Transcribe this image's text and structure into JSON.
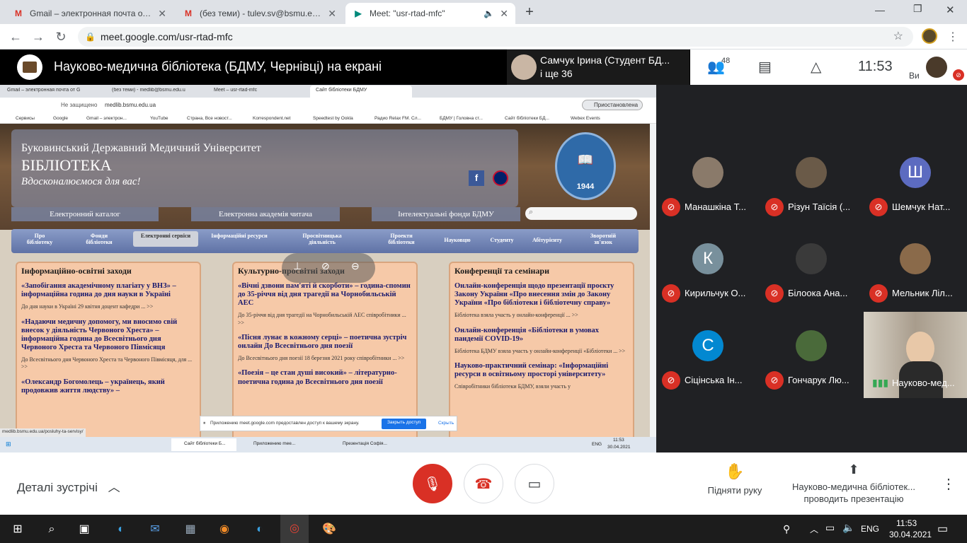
{
  "browser": {
    "tabs": [
      {
        "title": "Gmail – электронная почта от G",
        "icon": "gmail-icon"
      },
      {
        "title": "(без теми) - tulev.sv@bsmu.edu.u",
        "icon": "gmail-icon"
      },
      {
        "title": "Meet: \"usr-rtad-mfc\"",
        "icon": "meet-icon"
      }
    ],
    "url": "meet.google.com/usr-rtad-mfc"
  },
  "meet": {
    "presentation_title": "Науково-медична бібліотека (БДМУ, Чернівці) на екрані",
    "presenter_name": "Самчук Ірина (Студент БД...",
    "presenter_more": "і ще 36",
    "participant_count": "48",
    "time": "11:53",
    "self_label": "Ви"
  },
  "shared": {
    "tabs": [
      "Gmail – электронная почта от G",
      "(без теми) - medlib@bsmu.edu.u",
      "Meet – usr-rtad-mfc",
      "Сайт бібліотеки БДМУ"
    ],
    "not_secure": "Не защищено",
    "url": "medlib.bsmu.edu.ua",
    "paused": "Приостановлена",
    "bookmarks": [
      "Сервисы",
      "Google",
      "Gmail – электрон...",
      "YouTube",
      "Страна, Все новост...",
      "Korrespondent.net",
      "Speedtest by Ookla",
      "Радио Relax FM. Сл...",
      "БДМУ | Головна ст...",
      "Сайт бібліотеки БД...",
      "Webex Events"
    ],
    "university": "Буковинський Державний Медичний Університет",
    "library": "БІБЛІОТЕКА",
    "slogan": "Вдосконалюємося для вас!",
    "logo_year": "1944",
    "logo_text": "Бібліотека БДМУ",
    "btn_catalog": "Електронний каталог",
    "btn_academy": "Електронна академія читача",
    "btn_funds": "Інтелектуальні фонди БДМУ",
    "menu": [
      "Про бібліотеку",
      "Фонди бібліотеки",
      "Електронні сервіси",
      "Інформаційні ресурси",
      "Просвітницька діяльність",
      "Проекти бібліотеки",
      "Науковцю",
      "Студенту",
      "Абітурієнту",
      "Зворотній зв'язок"
    ],
    "col1": {
      "title": "Інформаційно-освітні заходи",
      "items": [
        {
          "h": "«Запобігання академічному плагіату у ВНЗ» – інформаційна година до дня науки в Україні",
          "p": "До дня науки в Україні 29 квітня доцент кафедри ... >>"
        },
        {
          "h": "«Надаючи медичну допомогу, ми вносимо свій внесок у діяльність Червоного Хреста» – інформаційна година до Всесвітнього дня Червоного Хреста та Червоного Півмісяця",
          "p": "До Всесвітнього дня Червоного Хреста та Червоного Півмісяця, для ... >>"
        },
        {
          "h": "«Олександр Богомолець – українець, який продовжив життя людству» –",
          "p": ""
        }
      ]
    },
    "col2": {
      "title": "Культурно-просвітні заходи",
      "items": [
        {
          "h": "«Вічні дзвони пам'яті й скорботи» – година-спомин до 35-річчя від дня трагедії на Чорнобильській АЕС",
          "p": "До 35-річчя від дня трагедії на Чорнобильській АЕС співробітники ... >>"
        },
        {
          "h": "«Пісня лунає в кожному серці» – поетична зустріч онлайн До Всесвітнього дня поезії",
          "p": "До Всесвітнього дня поезії 18 березня 2021 року співробітники ... >>"
        },
        {
          "h": "«Поезія – це стан душі високий» – літературно-поетична година до Всесвітнього дня поезії",
          "p": ""
        }
      ]
    },
    "col3": {
      "title": "Конференції та семінари",
      "items": [
        {
          "h": "Онлайн-конференція щодо презентації проєкту Закону України «Про внесення змін до Закону України «Про бібліотеки і бібліотечну справу»",
          "p": "Бібліотека взяла участь у онлайн-конференції ... >>"
        },
        {
          "h": "Онлайн-конференція «Бібліотеки в умовах пандемії COVID-19»",
          "p": "Бібліотека БДМУ взяла участь у онлайн-конференції «Бібліотеки ... >>"
        },
        {
          "h": "Науково-практичний семінар: «Інформаційні ресурси в освітньому просторі університету»",
          "p": "Співробітники бібліотеки БДМУ, взяли участь у"
        }
      ]
    },
    "status_url": "medlib.bsmu.edu.ua/posluhy-ta-servisy/",
    "share_text": "Приложению meet.google.com предоставлен доступ к вашему экрану.",
    "share_stop": "Закрыть доступ",
    "share_hide": "Скрыть",
    "task_items": [
      "Сайт бібліотеки Б...",
      "Приложению mee...",
      "Презентація Софія..."
    ],
    "task_lang": "ENG",
    "task_time": "11:53",
    "task_date": "30.04.2021"
  },
  "participants": [
    {
      "name": "Манашкіна Т...",
      "initial": "",
      "color": "#8a7a6a"
    },
    {
      "name": "Різун Таїсія (...",
      "initial": "",
      "color": "#6a5a48"
    },
    {
      "name": "Шемчук Нат...",
      "initial": "Ш",
      "color": "#5c6bc0"
    },
    {
      "name": "Кирильчук О...",
      "initial": "К",
      "color": "#78909c"
    },
    {
      "name": "Білоока Ана...",
      "initial": "",
      "color": "#3a3a3a"
    },
    {
      "name": "Мельник Ліл...",
      "initial": "",
      "color": "#8a6a4a"
    },
    {
      "name": "Сіцінська Ін...",
      "initial": "С",
      "color": "#0288d1"
    },
    {
      "name": "Гончарук Лю...",
      "initial": "",
      "color": "#4a6a3a"
    }
  ],
  "presenter_tile": "Науково-мед...",
  "bottom": {
    "details": "Деталі зустрічі",
    "raise_hand": "Підняти руку",
    "presenting_line1": "Науково-медична бібліотек...",
    "presenting_line2": "проводить презентацію"
  },
  "taskbar": {
    "lang": "ENG",
    "time": "11:53",
    "date": "30.04.2021"
  }
}
